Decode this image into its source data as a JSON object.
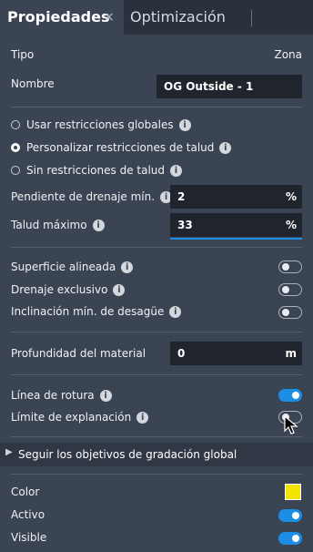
{
  "tabs": {
    "active": "Propiedades",
    "close_glyph": "×",
    "inactive": "Optimización"
  },
  "props": {
    "tipo_label": "Tipo",
    "tipo_value": "Zona",
    "nombre_label": "Nombre",
    "nombre_value": "OG Outside - 1"
  },
  "restrictions": {
    "options": [
      {
        "label": "Usar restricciones globales",
        "selected": false
      },
      {
        "label": "Personalizar restricciones de talud",
        "selected": true
      },
      {
        "label": "Sin restricciones de talud",
        "selected": false
      }
    ],
    "pendiente_label": "Pendiente de drenaje mín.",
    "pendiente_value": "2",
    "pendiente_unit": "%",
    "talud_label": "Talud máximo",
    "talud_value": "33",
    "talud_unit": "%"
  },
  "surface": {
    "alineada_label": "Superficie alineada",
    "alineada_on": false,
    "drenaje_label": "Drenaje exclusivo",
    "drenaje_on": false,
    "inclinacion_label": "Inclinación mín. de desagüe",
    "inclinacion_on": false
  },
  "material": {
    "label": "Profundidad del material",
    "value": "0",
    "unit": "m"
  },
  "lines": {
    "rotura_label": "Línea de rotura",
    "rotura_on": true,
    "limite_label": "Límite de explanación",
    "limite_on": false
  },
  "section": {
    "chevron": "▶",
    "label": "Seguir los objetivos de gradación global"
  },
  "appearance": {
    "color_label": "Color",
    "color_value": "#f2e600",
    "activo_label": "Activo",
    "activo_on": true,
    "visible_label": "Visible",
    "visible_on": true
  },
  "icons": {
    "info": "i"
  }
}
